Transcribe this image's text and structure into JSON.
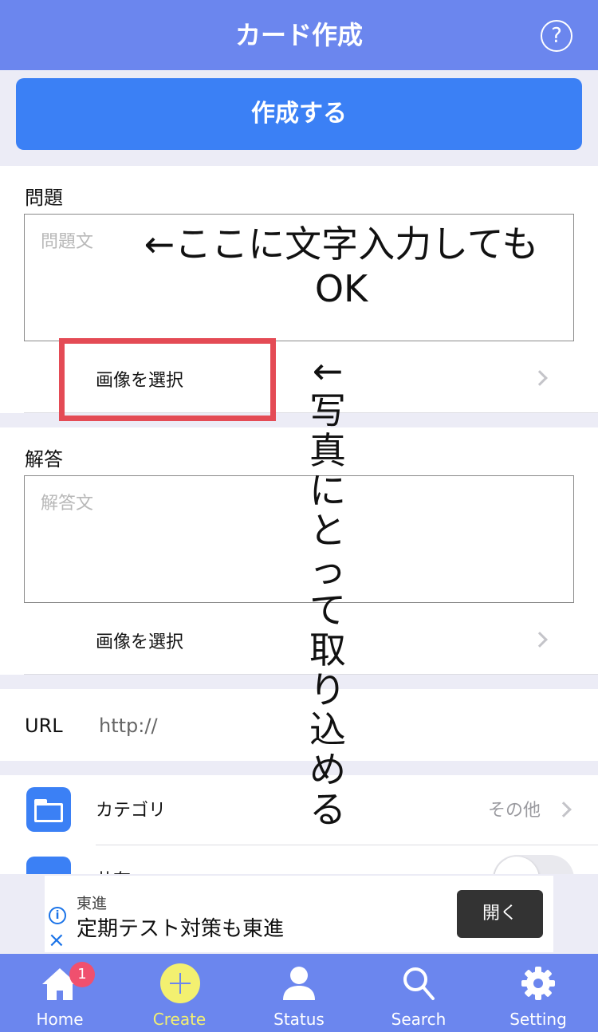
{
  "header": {
    "title": "カード作成",
    "help_label": "?"
  },
  "create_button": {
    "label": "作成する"
  },
  "question": {
    "label": "問題",
    "placeholder": "問題文",
    "image_select_label": "画像を選択"
  },
  "answer": {
    "label": "解答",
    "placeholder": "解答文",
    "image_select_label": "画像を選択"
  },
  "url": {
    "label": "URL",
    "value": "http://"
  },
  "category": {
    "label": "カテゴリ",
    "value": "その他"
  },
  "share": {
    "label": "共有",
    "enabled": false
  },
  "ad": {
    "sponsor": "東進",
    "headline": "定期テスト対策も東進",
    "open_button": "開く",
    "info_glyph": "i",
    "close_glyph": "×"
  },
  "tabbar": {
    "tabs": [
      {
        "label": "Home",
        "icon": "home-icon",
        "badge": "1"
      },
      {
        "label": "Create",
        "icon": "plus-icon",
        "active": true
      },
      {
        "label": "Status",
        "icon": "person-icon"
      },
      {
        "label": "Search",
        "icon": "search-icon"
      },
      {
        "label": "Setting",
        "icon": "gear-icon"
      }
    ]
  },
  "annotations": {
    "text_input_note": "←ここに文字入力してもOK",
    "photo_note": "←写真にとって取り込める",
    "highlight_color": "#e44b55"
  },
  "colors": {
    "header_bg": "#6b86ee",
    "primary_button": "#3b80f5",
    "create_tab_accent": "#f3f070",
    "badge": "#f0506e"
  }
}
